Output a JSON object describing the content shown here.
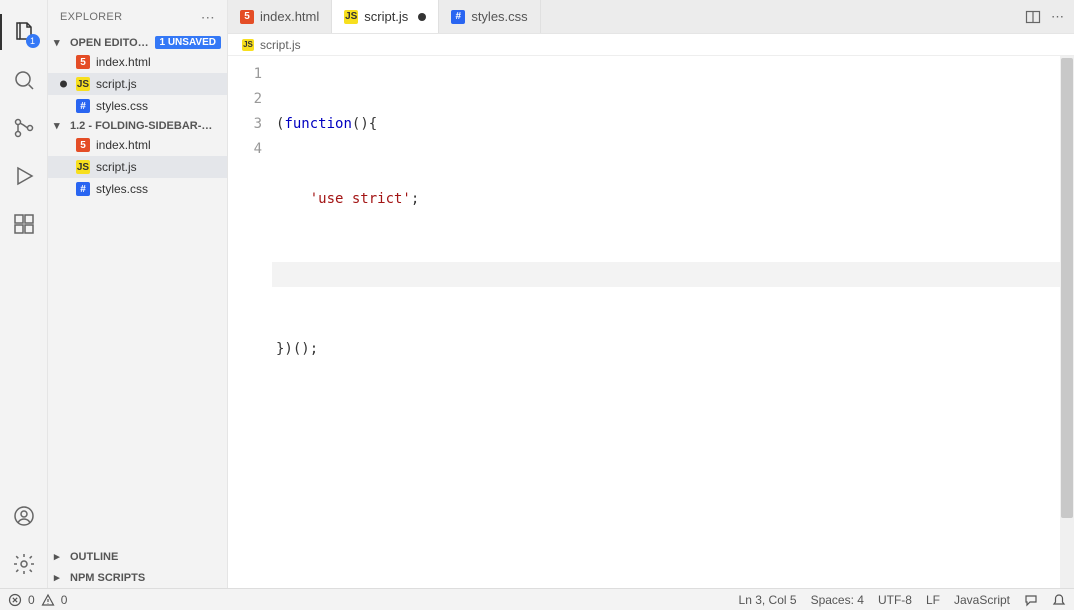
{
  "activity_badge": "1",
  "sidebar": {
    "title": "EXPLORER",
    "open_editors_label": "OPEN EDITO…",
    "unsaved_badge": "1 UNSAVED",
    "open_editors": [
      {
        "name": "index.html",
        "icon": "html",
        "dirty": false
      },
      {
        "name": "script.js",
        "icon": "js",
        "dirty": true
      },
      {
        "name": "styles.css",
        "icon": "css",
        "dirty": false
      }
    ],
    "folder_label": "1.2 - FOLDING-SIDEBAR-…",
    "folder_files": [
      {
        "name": "index.html",
        "icon": "html"
      },
      {
        "name": "script.js",
        "icon": "js"
      },
      {
        "name": "styles.css",
        "icon": "css"
      }
    ],
    "outline": "OUTLINE",
    "npm": "NPM SCRIPTS"
  },
  "tabs": [
    {
      "name": "index.html",
      "icon": "html",
      "active": false,
      "dirty": false
    },
    {
      "name": "script.js",
      "icon": "js",
      "active": true,
      "dirty": true
    },
    {
      "name": "styles.css",
      "icon": "css",
      "active": false,
      "dirty": false
    }
  ],
  "breadcrumb": {
    "file": "script.js",
    "icon": "js"
  },
  "code": {
    "lines": [
      "1",
      "2",
      "3",
      "4"
    ],
    "l1_a": "(",
    "l1_b": "function",
    "l1_c": "(",
    "l1_d": "){",
    "l2_indent": "    ",
    "l2_str": "'use strict'",
    "l2_end": ";",
    "l3": "    ",
    "l4": "})();"
  },
  "status": {
    "errors": "0",
    "warnings": "0",
    "ln_col": "Ln 3, Col 5",
    "spaces": "Spaces: 4",
    "encoding": "UTF-8",
    "eol": "LF",
    "lang": "JavaScript"
  }
}
